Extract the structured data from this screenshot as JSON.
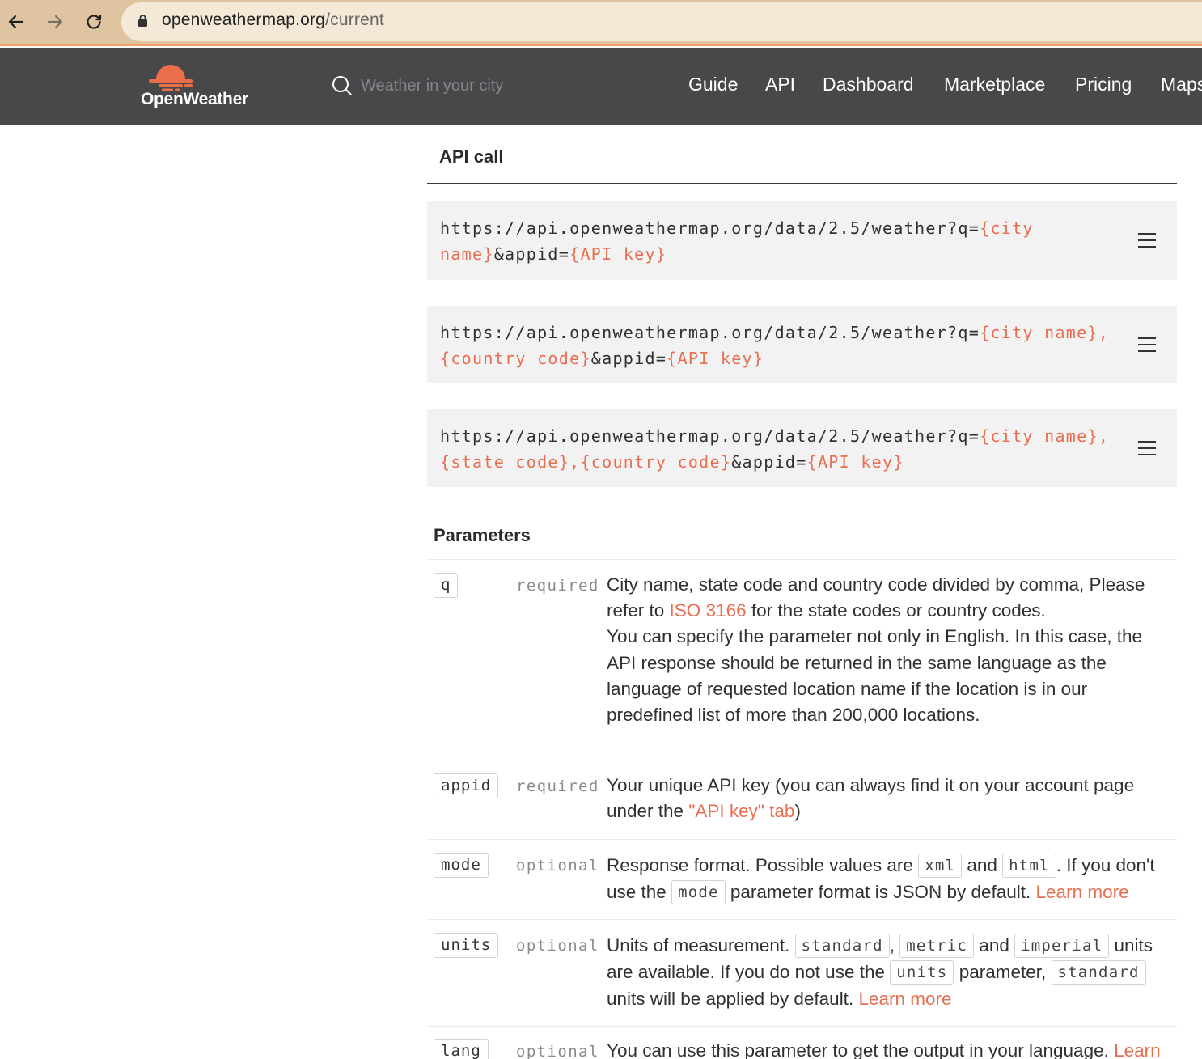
{
  "browser": {
    "url_domain": "openweathermap.org",
    "url_path": "/current"
  },
  "header": {
    "logo_text": "OpenWeather",
    "search_placeholder": "Weather in your city",
    "nav": [
      "Guide",
      "API",
      "Dashboard",
      "Marketplace",
      "Pricing",
      "Maps"
    ]
  },
  "api_call": {
    "title": "API call",
    "examples": [
      {
        "line1": [
          "https://api.openweathermap.org/data/2.5/weather?q=",
          "{city"
        ],
        "line2": [
          "name}",
          "&appid=",
          "{API key}"
        ]
      },
      {
        "line1": [
          "https://api.openweathermap.org/data/2.5/weather?q=",
          "{city name},"
        ],
        "line2": [
          "{country code}",
          "&appid=",
          "{API key}"
        ]
      },
      {
        "line1": [
          "https://api.openweathermap.org/data/2.5/weather?q=",
          "{city name},"
        ],
        "line2": [
          "{state code},{country code}",
          "&appid=",
          "{API key}"
        ]
      }
    ]
  },
  "parameters": {
    "title": "Parameters",
    "rows": [
      {
        "name": "q",
        "requirement": "required",
        "desc": {
          "t1": "City name, state code and country code divided by comma, Please refer to ",
          "link": "ISO 3166",
          "t2": " for the state codes or country codes.",
          "t3": "You can specify the parameter not only in English. In this case, the API response should be returned in the same language as the language of requested location name if the location is in our predefined list of more than 200,000 locations."
        }
      },
      {
        "name": "appid",
        "requirement": "required",
        "desc": {
          "t1": "Your unique API key (you can always find it on your account page under the ",
          "link": "\"API key\" tab",
          "t2": ")"
        }
      },
      {
        "name": "mode",
        "requirement": "optional",
        "desc": {
          "t1": "Response format. Possible values are ",
          "c1": "xml",
          "t2": " and ",
          "c2": "html",
          "t3": ". If you don't use the ",
          "c3": "mode",
          "t4": " parameter format is JSON by default. ",
          "link": "Learn more"
        }
      },
      {
        "name": "units",
        "requirement": "optional",
        "desc": {
          "t1": "Units of measurement. ",
          "c1": "standard",
          "t2": ", ",
          "c2": "metric",
          "t3": " and ",
          "c3": "imperial",
          "t4": " units are available. If you do not use the ",
          "c4": "units",
          "t5": " parameter, ",
          "c5": "standard",
          "t6": " units will be applied by default. ",
          "link": "Learn more"
        }
      },
      {
        "name": "lang",
        "requirement": "optional",
        "desc": {
          "t1": "You can use this parameter to get the output in your language. ",
          "link": "Learn"
        }
      }
    ]
  },
  "colors": {
    "accent": "#e96e50",
    "header_bg": "#48484a",
    "browser_bar": "#dfc4a1",
    "code_bg": "#f2f2f2"
  },
  "icons": [
    "back-arrow-icon",
    "forward-arrow-icon",
    "reload-icon",
    "lock-icon",
    "openweather-logo-icon",
    "search-icon",
    "menu-lines-icon"
  ]
}
